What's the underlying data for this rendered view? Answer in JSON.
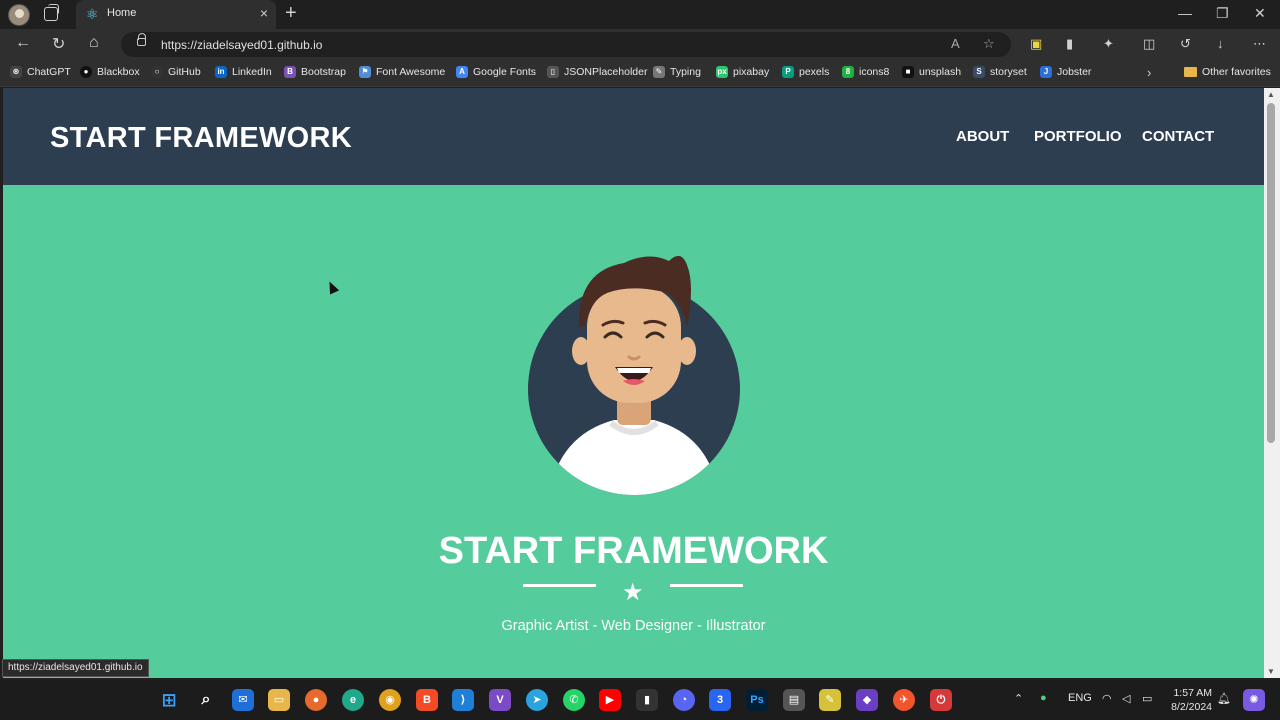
{
  "browser": {
    "tab_title": "Home",
    "tab_close": "×",
    "new_tab": "+",
    "url": "https://ziadelsayed01.github.io",
    "status_url": "https://ziadelsayed01.github.io"
  },
  "bookmarks": [
    {
      "label": "ChatGPT",
      "color": "#444444",
      "glyph": "⊛"
    },
    {
      "label": "Blackbox",
      "color": "#111111",
      "glyph": "●"
    },
    {
      "label": "GitHub",
      "color": "#333333",
      "glyph": "○"
    },
    {
      "label": "LinkedIn",
      "color": "#0a66c2",
      "glyph": "in"
    },
    {
      "label": "Bootstrap",
      "color": "#7952b3",
      "glyph": "B"
    },
    {
      "label": "Font Awesome",
      "color": "#538dd7",
      "glyph": "⚑"
    },
    {
      "label": "Google Fonts",
      "color": "#4285f4",
      "glyph": "A"
    },
    {
      "label": "JSONPlaceholder",
      "color": "#555555",
      "glyph": "▯"
    },
    {
      "label": "Typing",
      "color": "#777777",
      "glyph": "✎"
    },
    {
      "label": "pixabay",
      "color": "#2ec66d",
      "glyph": "px"
    },
    {
      "label": "pexels",
      "color": "#05a081",
      "glyph": "P"
    },
    {
      "label": "icons8",
      "color": "#1fb141",
      "glyph": "8"
    },
    {
      "label": "unsplash",
      "color": "#111111",
      "glyph": "■"
    },
    {
      "label": "storyset",
      "color": "#3a4a6b",
      "glyph": "S"
    },
    {
      "label": "Jobster",
      "color": "#2c6fd6",
      "glyph": "J"
    }
  ],
  "other_favorites": "Other favorites",
  "site": {
    "brand": "START FRAMEWORK",
    "nav": [
      "ABOUT",
      "PORTFOLIO",
      "CONTACT"
    ],
    "hero_title": "START FRAMEWORK",
    "subtitle": "Graphic Artist - Web Designer - Illustrator"
  },
  "colors": {
    "navbar": "#2c3e50",
    "hero": "#55cc9c"
  },
  "taskbar": {
    "language": "ENG",
    "time": "1:57 AM",
    "date": "8/2/2024"
  }
}
